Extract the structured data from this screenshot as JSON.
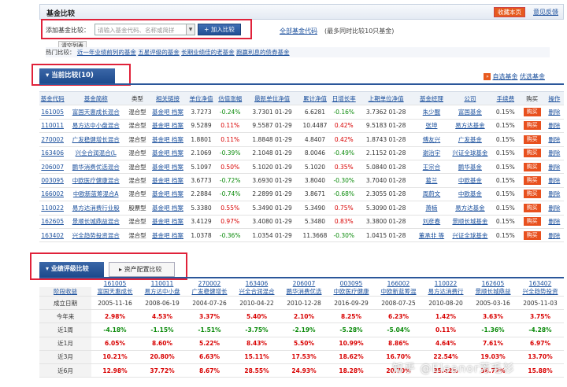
{
  "header": {
    "title": "基金比较",
    "favorite": "收藏本页",
    "feedback": "意见反馈"
  },
  "add": {
    "label": "添加基金比较：",
    "placeholder": "请输入基金代码、名称或简拼",
    "button": "加入比较",
    "all_funds": "全部基金代码",
    "note": "(最多同时比较10只基金)",
    "clear": "清空列表"
  },
  "hot": {
    "label": "热门比较：",
    "items": [
      "近一年业绩前列的基金",
      "五星评级的基金",
      "长期业绩佳的老基金",
      "跑赢利息的债券基金"
    ]
  },
  "current": {
    "tab": "当前比较(10)",
    "links": [
      "自选基金",
      "优选基金"
    ]
  },
  "table": {
    "headers": [
      "基金代码",
      "基金简称",
      "类型",
      "相关链接",
      "单位净值",
      "估值涨幅",
      "最新单位净值",
      "累计净值",
      "日增长率",
      "上期单位净值",
      "基金经理",
      "公司",
      "手续费",
      "购买",
      "操作"
    ],
    "rows": [
      [
        "161005",
        "富国天惠成长混合",
        "混合型",
        "基金吧 档案",
        "3.7273",
        "-0.24%",
        "3.7301",
        "01-29",
        "6.6281",
        "-0.16%",
        "3.7362",
        "01-28",
        "朱少醒",
        "富国基金",
        "0.15%",
        "购买",
        "删除"
      ],
      [
        "110011",
        "易方达中小盘混合",
        "混合型",
        "基金吧 档案",
        "9.5289",
        "0.11%",
        "9.5587",
        "01-29",
        "10.4487",
        "0.42%",
        "9.5183",
        "01-28",
        "张坤",
        "易方达基金",
        "0.15%",
        "购买",
        "删除"
      ],
      [
        "270002",
        "广发稳健增长混合",
        "混合型",
        "基金吧 档案",
        "1.8801",
        "0.11%",
        "1.8848",
        "01-29",
        "4.8407",
        "0.42%",
        "1.8743",
        "01-28",
        "傅友兴",
        "广发基金",
        "0.15%",
        "购买",
        "删除"
      ],
      [
        "163406",
        "兴全合润混合(L",
        "混合型",
        "基金吧 档案",
        "2.1069",
        "-0.39%",
        "2.1048",
        "01-29",
        "8.0046",
        "-0.49%",
        "2.1152",
        "01-28",
        "谢治宇",
        "兴证全球基金",
        "0.15%",
        "购买",
        "删除"
      ],
      [
        "206007",
        "鹏华消费优选混合",
        "混合型",
        "基金吧 档案",
        "5.1097",
        "0.50%",
        "5.1020",
        "01-29",
        "5.1020",
        "0.35%",
        "5.0840",
        "01-28",
        "王宗合",
        "鹏华基金",
        "0.15%",
        "购买",
        "删除"
      ],
      [
        "003095",
        "中欧医疗健康混合",
        "混合型",
        "基金吧 档案",
        "3.6773",
        "-0.72%",
        "3.6930",
        "01-29",
        "3.8040",
        "-0.30%",
        "3.7040",
        "01-28",
        "葛兰",
        "中欧基金",
        "0.15%",
        "购买",
        "删除"
      ],
      [
        "166002",
        "中欧新蓝筹混合A",
        "混合型",
        "基金吧 档案",
        "2.2884",
        "-0.74%",
        "2.2899",
        "01-29",
        "3.8671",
        "-0.68%",
        "2.3055",
        "01-28",
        "周蔚文",
        "中欧基金",
        "0.15%",
        "购买",
        "删除"
      ],
      [
        "110022",
        "易方达消费行业股",
        "股票型",
        "基金吧 档案",
        "5.3380",
        "0.55%",
        "5.3490",
        "01-29",
        "5.3490",
        "0.75%",
        "5.3090",
        "01-28",
        "萧楠",
        "易方达基金",
        "0.15%",
        "购买",
        "删除"
      ],
      [
        "162605",
        "景顺长城鼎益混合",
        "混合型",
        "基金吧 档案",
        "3.4129",
        "0.97%",
        "3.4080",
        "01-29",
        "5.3480",
        "0.83%",
        "3.3800",
        "01-28",
        "刘彦春",
        "景顺长城基金",
        "0.15%",
        "购买",
        "删除"
      ],
      [
        "163402",
        "兴全趋势投资混合",
        "混合型",
        "基金吧 档案",
        "1.0378",
        "-0.36%",
        "1.0354",
        "01-29",
        "11.3668",
        "-0.30%",
        "1.0415",
        "01-28",
        "董承非 等",
        "兴证全球基金",
        "0.15%",
        "购买",
        "删除"
      ]
    ]
  },
  "perf": {
    "tab": "业绩评级比较",
    "tab2": "资产配置比较",
    "codes": [
      "161005",
      "110011",
      "270002",
      "163406",
      "206007",
      "003095",
      "166002",
      "110022",
      "162605",
      "163402"
    ],
    "names": [
      "富国天惠成长",
      "易方达中小盘",
      "广发稳健增长",
      "兴全合润混合",
      "鹏华消费优选",
      "中欧医疗健康",
      "中欧新蓝筹混",
      "易方达消费行",
      "景顺长城鼎益",
      "兴全趋势投资"
    ],
    "row_label_head": "阶段收益",
    "date_label": "成立日期",
    "dates": [
      "2005-11-16",
      "2008-06-19",
      "2004-07-26",
      "2010-04-22",
      "2010-12-28",
      "2016-09-29",
      "2008-07-25",
      "2010-08-20",
      "2005-03-16",
      "2005-11-03"
    ],
    "rows": [
      {
        "label": "今年来",
        "values": [
          "2.98%",
          "4.53%",
          "3.37%",
          "5.40%",
          "2.10%",
          "8.25%",
          "6.23%",
          "1.42%",
          "3.63%",
          "3.75%"
        ]
      },
      {
        "label": "近1周",
        "values": [
          "-4.18%",
          "-1.15%",
          "-1.51%",
          "-3.75%",
          "-2.19%",
          "-5.28%",
          "-5.04%",
          "0.11%",
          "-1.36%",
          "-4.28%"
        ]
      },
      {
        "label": "近1月",
        "values": [
          "6.05%",
          "8.60%",
          "5.22%",
          "8.43%",
          "5.50%",
          "10.99%",
          "8.86%",
          "4.64%",
          "7.61%",
          "6.97%"
        ]
      },
      {
        "label": "近3月",
        "values": [
          "10.21%",
          "20.80%",
          "6.63%",
          "15.11%",
          "17.53%",
          "18.62%",
          "16.70%",
          "22.54%",
          "19.03%",
          "13.70%"
        ]
      },
      {
        "label": "近6月",
        "values": [
          "12.98%",
          "37.72%",
          "8.67%",
          "28.55%",
          "24.93%",
          "18.28%",
          "20.70%",
          "35.42%",
          "38.72%",
          "15.88%"
        ]
      }
    ]
  },
  "watermark": "知乎 @Eleanor芳毛衫"
}
